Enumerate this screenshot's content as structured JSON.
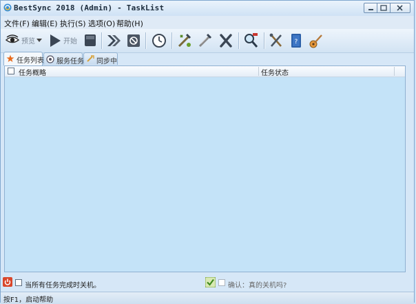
{
  "window": {
    "title": "BestSync 2018 (Admin) - TaskList"
  },
  "menu": [
    {
      "label": "文件(F)"
    },
    {
      "label": "编辑(E)"
    },
    {
      "label": "执行(S)"
    },
    {
      "label": "选项(O)"
    },
    {
      "label": "帮助(H)"
    }
  ],
  "toolbar": {
    "preview_label": "预览",
    "start_label": "开始"
  },
  "tabs": [
    {
      "label": "任务列表",
      "active": true
    },
    {
      "label": "服务任务",
      "active": false
    },
    {
      "label": "同步中",
      "active": false
    }
  ],
  "list": {
    "columns": [
      {
        "label": "任务概略"
      },
      {
        "label": "任务状态"
      }
    ],
    "rows": []
  },
  "footer": {
    "shutdown_label": "当所有任务完成时关机。",
    "confirm_label": "确认：真的关机吗?"
  },
  "status": {
    "text": "按F1，启动帮助"
  },
  "colors": {
    "list_bg": "#c4e3f8",
    "window_bg": "#d6e7f7",
    "accent_border": "#8fb0d1"
  }
}
